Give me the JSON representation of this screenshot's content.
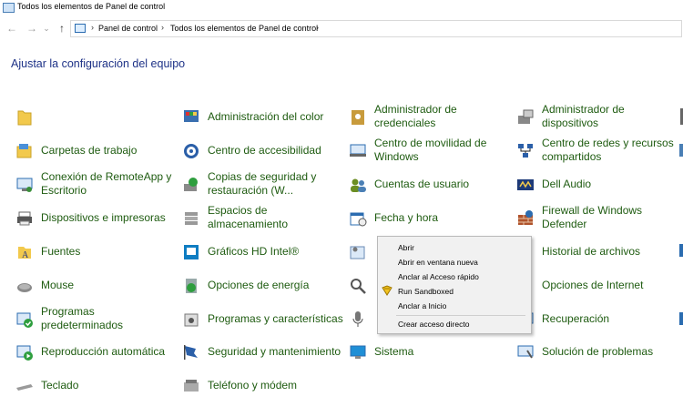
{
  "window": {
    "title": "Todos los elementos de Panel de control"
  },
  "nav": {
    "back_glyph": "←",
    "forward_glyph": "→",
    "recent_glyph": "⌄",
    "up_glyph": "↑",
    "separator": "›"
  },
  "address": {
    "segments": [
      "Panel de control",
      "Todos los elementos de Panel de control"
    ]
  },
  "heading": "Ajustar la configuración del equipo",
  "columns": [
    [
      {
        "label": "",
        "icon": "folder-icon"
      },
      {
        "label": "Carpetas de trabajo",
        "icon": "work-folders-icon"
      },
      {
        "label": "Conexión de RemoteApp y Escritorio",
        "icon": "remoteapp-icon"
      },
      {
        "label": "Dispositivos e impresoras",
        "icon": "printer-icon"
      },
      {
        "label": "Fuentes",
        "icon": "fonts-icon"
      },
      {
        "label": "Mouse",
        "icon": "mouse-icon"
      },
      {
        "label": "Programas predeterminados",
        "icon": "default-programs-icon"
      },
      {
        "label": "Reproducción automática",
        "icon": "autoplay-icon"
      },
      {
        "label": "Teclado",
        "icon": "keyboard-icon"
      }
    ],
    [
      {
        "label": "Administración del color",
        "icon": "color-management-icon"
      },
      {
        "label": "Centro de accesibilidad",
        "icon": "accessibility-icon"
      },
      {
        "label": "Copias de seguridad y restauración (W...",
        "icon": "backup-icon"
      },
      {
        "label": "Espacios de almacenamiento",
        "icon": "storage-spaces-icon"
      },
      {
        "label": "Gráficos HD Intel®",
        "icon": "intel-graphics-icon"
      },
      {
        "label": "Opciones de energía",
        "icon": "power-options-icon"
      },
      {
        "label": "Programas y características",
        "icon": "programs-features-icon"
      },
      {
        "label": "Seguridad y mantenimiento",
        "icon": "security-flag-icon"
      },
      {
        "label": "Teléfono y módem",
        "icon": "phone-modem-icon"
      }
    ],
    [
      {
        "label": "Administrador de credenciales",
        "icon": "credentials-icon"
      },
      {
        "label": "Centro de movilidad de Windows",
        "icon": "mobility-icon"
      },
      {
        "label": "Cuentas de usuario",
        "icon": "user-accounts-icon"
      },
      {
        "label": "Fecha y hora",
        "icon": "date-time-icon"
      },
      {
        "label": "",
        "icon": "admin-tools-icon"
      },
      {
        "label": "",
        "icon": "search-icon"
      },
      {
        "label": "",
        "icon": "microphone-icon"
      },
      {
        "label": "Sistema",
        "icon": "system-icon"
      },
      {
        "label": "",
        "icon": "blank-icon"
      }
    ],
    [
      {
        "label": "Administrador de dispositivos",
        "icon": "device-manager-icon"
      },
      {
        "label": "Centro de redes y recursos compartidos",
        "icon": "network-icon"
      },
      {
        "label": "Dell Audio",
        "icon": "dell-audio-icon"
      },
      {
        "label": "Firewall de Windows Defender",
        "icon": "firewall-icon"
      },
      {
        "label": "Historial de archivos",
        "icon": "file-history-icon"
      },
      {
        "label": "Opciones de Internet",
        "icon": "internet-options-icon"
      },
      {
        "label": "Recuperación",
        "icon": "recovery-icon"
      },
      {
        "label": "Solución de problemas",
        "icon": "troubleshoot-icon"
      },
      {
        "label": "",
        "icon": "blank-icon"
      }
    ]
  ],
  "context_menu": {
    "items": [
      "Abrir",
      "Abrir en ventana nueva",
      "Anclar al Acceso rápido",
      "Run Sandboxed",
      "Anclar a Inicio",
      "Crear acceso directo"
    ]
  }
}
